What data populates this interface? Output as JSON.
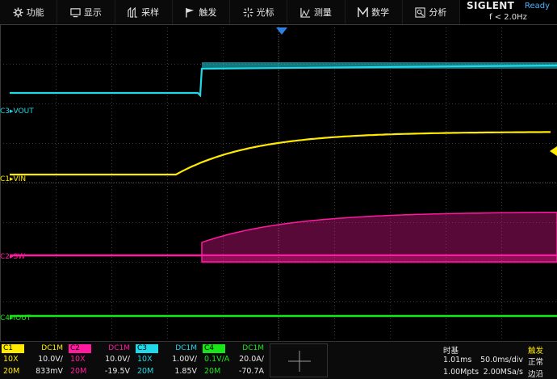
{
  "menu": [
    {
      "id": "function",
      "label": "功能",
      "icon": "gear-icon"
    },
    {
      "id": "display",
      "label": "显示",
      "icon": "monitor-icon"
    },
    {
      "id": "acquire",
      "label": "采样",
      "icon": "sample-icon"
    },
    {
      "id": "trigger",
      "label": "触发",
      "icon": "flag-icon"
    },
    {
      "id": "cursor",
      "label": "光标",
      "icon": "crosshair-icon"
    },
    {
      "id": "measure",
      "label": "测量",
      "icon": "measure-icon"
    },
    {
      "id": "math",
      "label": "数学",
      "icon": "math-icon"
    },
    {
      "id": "analyze",
      "label": "分析",
      "icon": "analyze-icon"
    }
  ],
  "brand": {
    "name": "SIGLENT",
    "status": "Ready",
    "freq": "f < 2.0Hz"
  },
  "colors": {
    "c1": "#ffea00",
    "c2": "#ff1aa0",
    "c3": "#20d8e8",
    "c4": "#19e619",
    "grid": "#3a3a3a"
  },
  "channels": {
    "c1": {
      "badge": "C1",
      "coupling": "DC1M",
      "probe": "10X",
      "scale": "10.0V/",
      "bw": "20M",
      "offset": "833mV",
      "label": "VIN"
    },
    "c2": {
      "badge": "C2",
      "coupling": "DC1M",
      "probe": "10X",
      "scale": "10.0V/",
      "bw": "20M",
      "offset": "-19.5V",
      "label": "SW"
    },
    "c3": {
      "badge": "C3",
      "coupling": "DC1M",
      "probe": "10X",
      "scale": "1.00V/",
      "bw": "20M",
      "offset": "1.85V",
      "label": "VOUT"
    },
    "c4": {
      "badge": "C4",
      "coupling": "DC1M",
      "probe": "0.1V/A",
      "scale": "20.0A/",
      "bw": "20M",
      "offset": "-70.7A",
      "label": "IOUT"
    }
  },
  "timebase": {
    "title": "时基",
    "delay": "1.01ms",
    "scale": "50.0ms/div",
    "points": "1.00Mpts",
    "rate": "2.00MSa/s"
  },
  "trigger": {
    "title": "触发",
    "mode": "正常",
    "type": "边沿"
  }
}
